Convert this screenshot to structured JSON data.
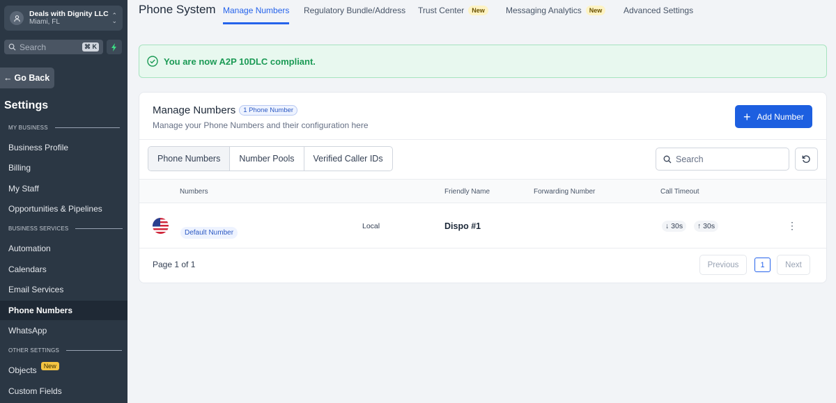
{
  "sidebar": {
    "account_name": "Deals with Dignity LLC",
    "account_location": "Miami, FL",
    "search_placeholder": "Search",
    "search_shortcut": "⌘ K",
    "go_back": "Go Back",
    "settings_title": "Settings",
    "sections": {
      "my_business": "MY BUSINESS",
      "business_services": "BUSINESS SERVICES",
      "other_settings": "OTHER SETTINGS"
    },
    "items": [
      {
        "label": "Business Profile"
      },
      {
        "label": "Billing"
      },
      {
        "label": "My Staff"
      },
      {
        "label": "Opportunities & Pipelines"
      },
      {
        "label": "Automation"
      },
      {
        "label": "Calendars"
      },
      {
        "label": "Email Services"
      },
      {
        "label": "Phone Numbers",
        "active": true
      },
      {
        "label": "WhatsApp"
      },
      {
        "label": "Objects",
        "badge": "New"
      },
      {
        "label": "Custom Fields"
      }
    ]
  },
  "header": {
    "title": "Phone System",
    "tabs": [
      {
        "label": "Manage Numbers",
        "active": true
      },
      {
        "label": "Regulatory Bundle/Address"
      },
      {
        "label": "Trust Center",
        "badge": "New"
      },
      {
        "label": "Messaging Analytics",
        "badge": "New"
      },
      {
        "label": "Advanced Settings"
      }
    ]
  },
  "alert": {
    "text": "You are now A2P 10DLC compliant."
  },
  "card": {
    "title": "Manage Numbers",
    "count_badge": "1 Phone Number",
    "subtitle": "Manage your Phone Numbers and their configuration here",
    "add_button": "Add Number",
    "segments": [
      "Phone Numbers",
      "Number Pools",
      "Verified Caller IDs"
    ],
    "search_placeholder": "Search",
    "columns": [
      "Numbers",
      "Friendly Name",
      "Forwarding Number",
      "Call Timeout"
    ],
    "rows": [
      {
        "badge": "Default Number",
        "type": "Local",
        "friendly_name": "Dispo #1",
        "timeout_in": "30s",
        "timeout_out": "30s"
      }
    ],
    "pager": {
      "label": "Page 1 of 1",
      "previous": "Previous",
      "page": "1",
      "next": "Next"
    }
  },
  "colors": {
    "accent": "#1d5fe0",
    "success": "#1b9a55",
    "sidebar_bg": "#2b3744"
  },
  "icons": [
    "user-icon",
    "chevron-updown-icon",
    "search-icon",
    "bolt-icon",
    "arrow-left-icon",
    "check-circle-icon",
    "plus-icon",
    "refresh-icon",
    "us-flag-icon",
    "arrow-down-icon",
    "arrow-up-icon",
    "more-vertical-icon"
  ]
}
